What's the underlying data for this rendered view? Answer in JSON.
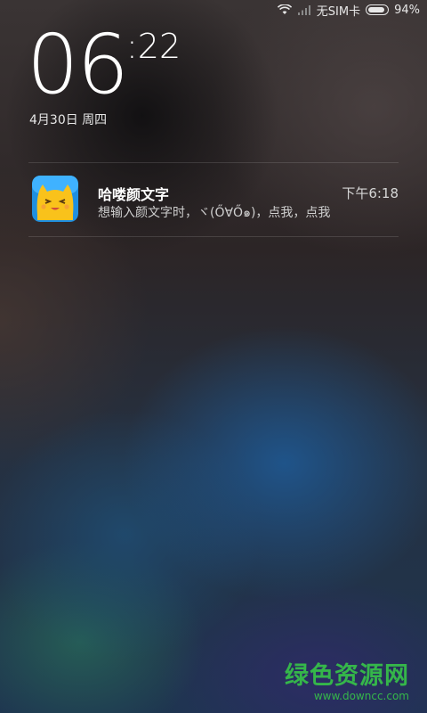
{
  "status_bar": {
    "icons": [
      "wifi-icon",
      "signal-icon"
    ],
    "carrier": "无SIM卡",
    "battery_percent": "94%",
    "battery_level": 0.94
  },
  "lock_screen": {
    "clock_hour": "06",
    "clock_minute": ":22",
    "date": "4月30日 周四"
  },
  "notification": {
    "app_icon": "cat-face-icon",
    "title": "哈喽颜文字",
    "time": "下午6:18",
    "body": "想输入颜文字时，ヾ(Ő∀Ő๑)，点我，点我"
  },
  "watermark": {
    "name": "绿色资源网",
    "url": "www.downcc.com",
    "color": "#35b64a"
  }
}
